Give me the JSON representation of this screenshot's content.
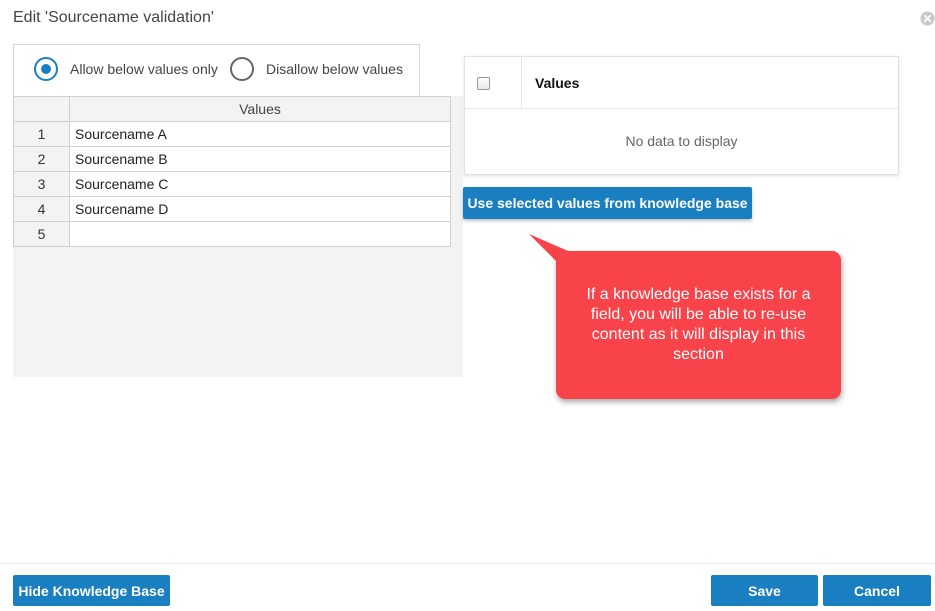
{
  "dialog": {
    "title": "Edit 'Sourcename validation'"
  },
  "radio": {
    "allow_label": "Allow below values only",
    "disallow_label": "Disallow below values",
    "selected": "allow"
  },
  "values_grid": {
    "header": "Values",
    "rows": [
      {
        "index": "1",
        "value": "Sourcename A"
      },
      {
        "index": "2",
        "value": "Sourcename B"
      },
      {
        "index": "3",
        "value": "Sourcename C"
      },
      {
        "index": "4",
        "value": "Sourcename D"
      },
      {
        "index": "5",
        "value": ""
      }
    ]
  },
  "knowledge_base": {
    "column_title": "Values",
    "empty_text": "No data to display",
    "use_button_label": "Use selected values from knowledge base"
  },
  "callout": {
    "text": "If a knowledge base exists for a field, you will be able to re-use content as it will display in this section"
  },
  "footer": {
    "hide_kb_label": "Hide Knowledge Base",
    "save_label": "Save",
    "cancel_label": "Cancel"
  },
  "colors": {
    "primary": "#1a7fc1",
    "callout": "#f9434a"
  },
  "icons": {
    "close": "close-icon"
  }
}
